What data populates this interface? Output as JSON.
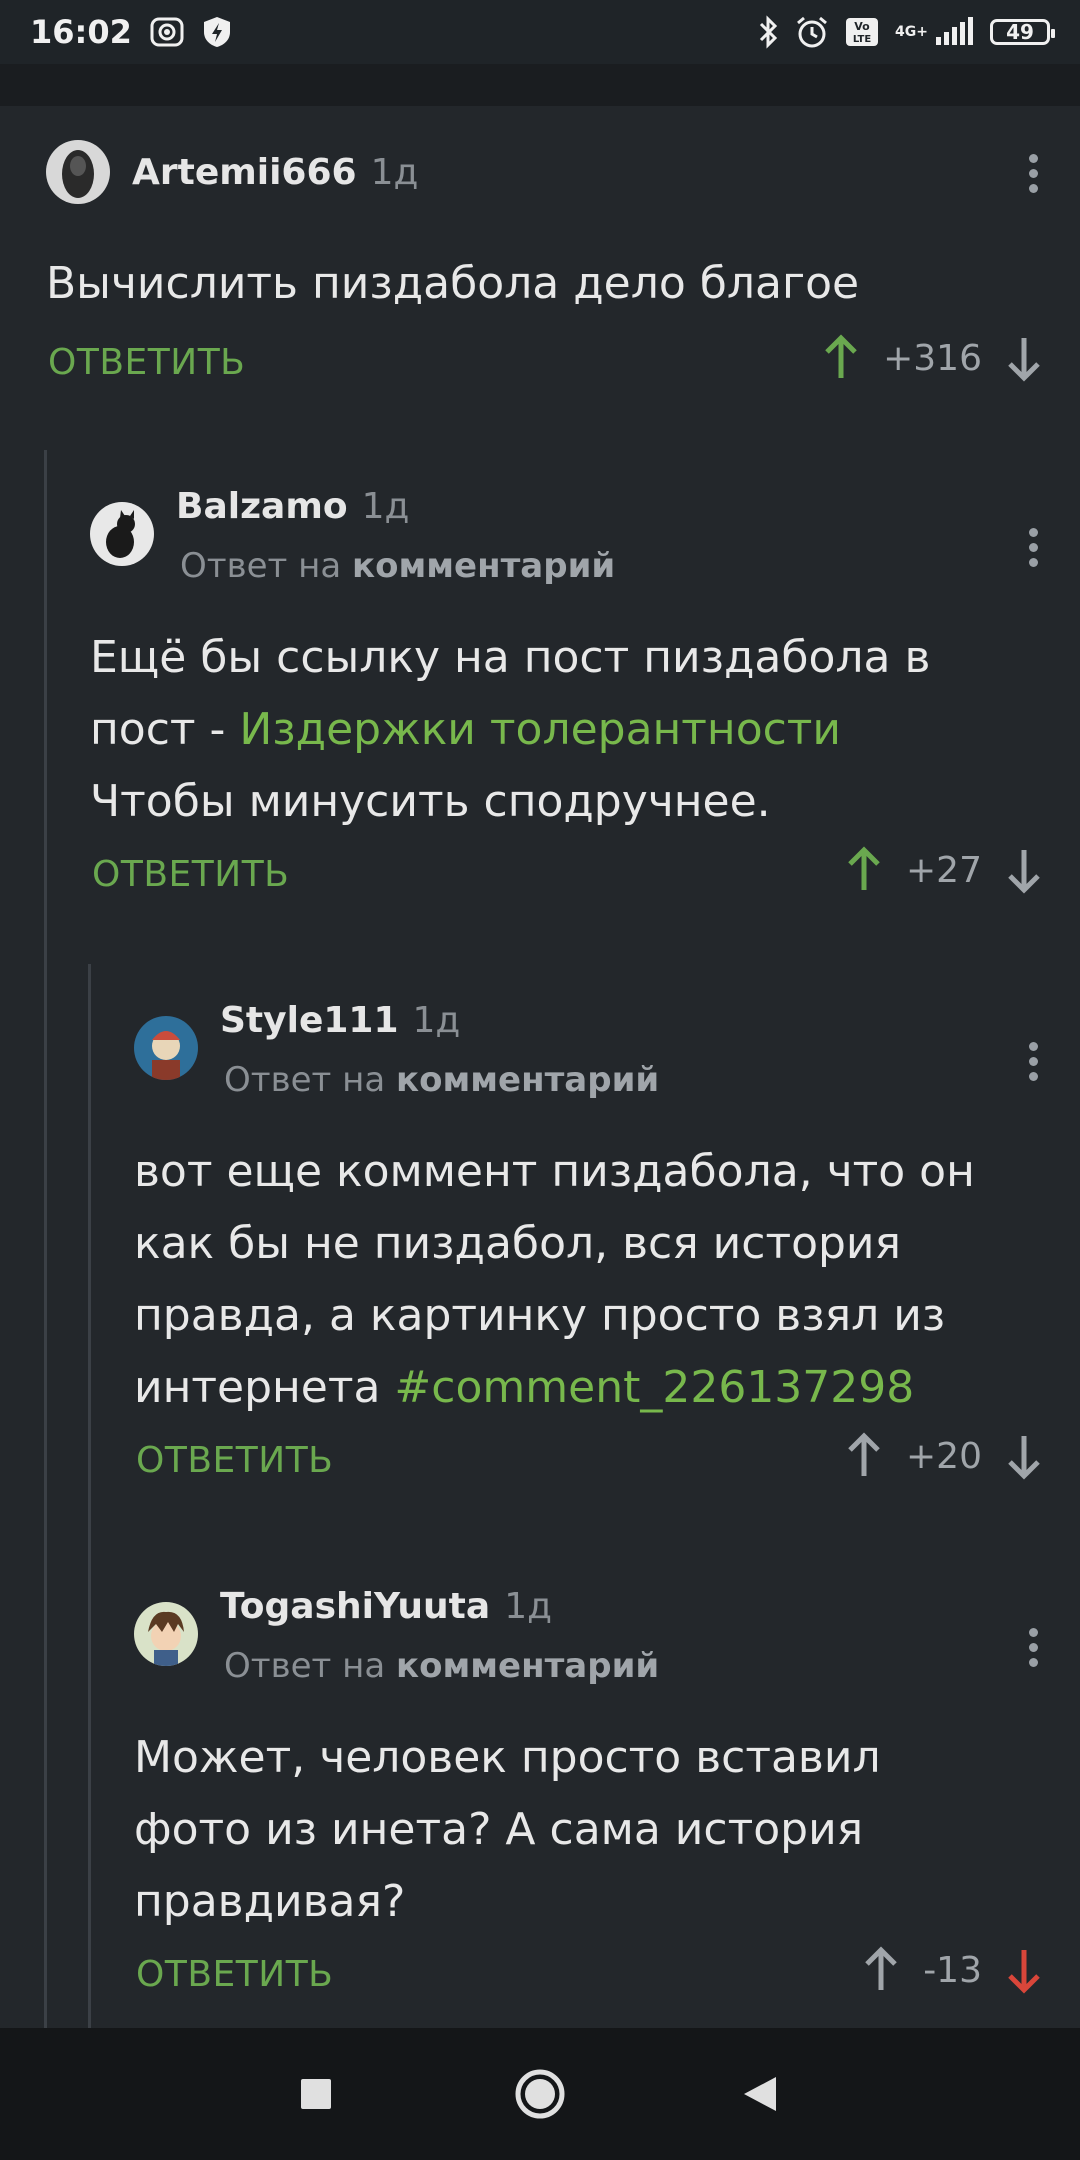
{
  "status_bar": {
    "time": "16:02",
    "network": "4G+",
    "battery": "49",
    "icons": [
      "camera-icon",
      "shield-icon",
      "bluetooth-icon",
      "alarm-icon",
      "volte-icon",
      "signal-icon",
      "battery-icon"
    ]
  },
  "comments": [
    {
      "author": "Artemii666",
      "time": "1д",
      "reply_to": null,
      "text": "Вычислить пиздабола дело благое",
      "reply_label": "ОТВЕТИТЬ",
      "score": "+316",
      "vote_state": "up"
    },
    {
      "author": "Balzamo",
      "time": "1д",
      "reply_to_prefix": "Ответ на",
      "reply_to_target": "комментарий",
      "text_lines": [
        "Ещё бы ссылку на пост пиздабола в",
        "пост - ",
        "Чтобы минусить сподручнее."
      ],
      "link_text": "Издержки толерантности",
      "reply_label": "ОТВЕТИТЬ",
      "score": "+27",
      "vote_state": "up"
    },
    {
      "author": "Style111",
      "time": "1д",
      "reply_to_prefix": "Ответ на",
      "reply_to_target": "комментарий",
      "text_lines": [
        "вот еще коммент пиздабола, что он",
        "как бы не пиздабол, вся история",
        "правда, а картинку просто взял из",
        "интернета "
      ],
      "link_text": "#comment_226137298",
      "reply_label": "ОТВЕТИТЬ",
      "score": "+20",
      "vote_state": "none"
    },
    {
      "author": "TogashiYuuta",
      "time": "1д",
      "reply_to_prefix": "Ответ на",
      "reply_to_target": "комментарий",
      "text_lines": [
        "Может, человек просто вставил",
        "фото из инета? А сама история",
        "правдивая?"
      ],
      "reply_label": "ОТВЕТИТЬ",
      "score": "-13",
      "vote_state": "down"
    }
  ],
  "colors": {
    "accent_green": "#6aa84f",
    "link_green": "#78b84c",
    "downvote_red": "#d9463a",
    "background": "#23272b"
  },
  "nav": [
    "recent-apps-icon",
    "home-icon",
    "back-icon"
  ]
}
